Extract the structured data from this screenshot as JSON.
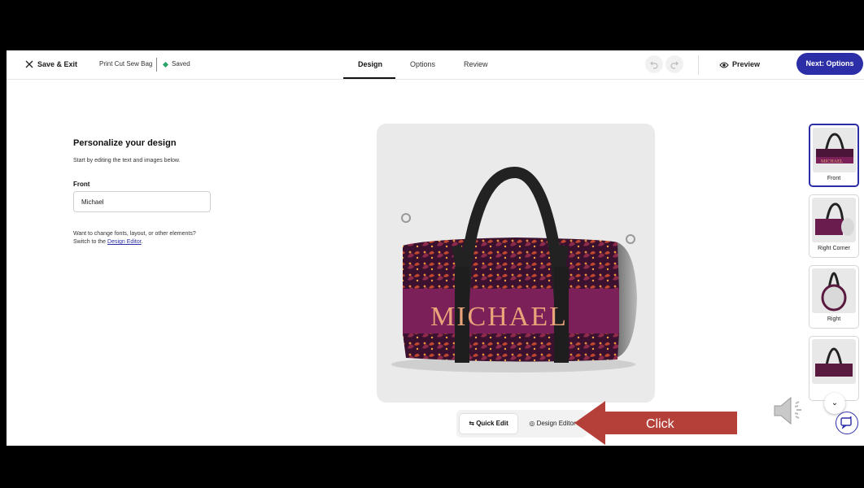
{
  "header": {
    "save_exit": "Save & Exit",
    "product_name": "Print Cut Sew Bag",
    "saved_status": "Saved",
    "tabs": [
      {
        "label": "Design",
        "active": true
      },
      {
        "label": "Options",
        "active": false
      },
      {
        "label": "Review",
        "active": false
      }
    ],
    "undo_icon": "undo-icon",
    "redo_icon": "redo-icon",
    "preview_label": "Preview",
    "next_label": "Next: Options"
  },
  "left_panel": {
    "title": "Personalize your design",
    "subtitle": "Start by editing the text and images below.",
    "front_label": "Front",
    "front_value": "Michael",
    "help_line1": "Want to change fonts, layout, or other elements?",
    "help_prefix": "Switch to the ",
    "help_link": "Design Editor",
    "help_suffix": "."
  },
  "canvas": {
    "product_text": "MICHAEL"
  },
  "toolbar": {
    "quick_edit": "Quick Edit",
    "design_editor": "Design Editor"
  },
  "thumbnails": [
    {
      "label": "Front",
      "selected": true
    },
    {
      "label": "Right Corner",
      "selected": false
    },
    {
      "label": "Right",
      "selected": false
    },
    {
      "label": "",
      "selected": false
    }
  ],
  "annotation": {
    "arrow_label": "Click"
  },
  "colors": {
    "brand": "#2c2ea8",
    "saved": "#2aa36b",
    "bag_purple": "#7b2059",
    "bag_text": "#e9a47a",
    "arrow": "#b5403a"
  }
}
